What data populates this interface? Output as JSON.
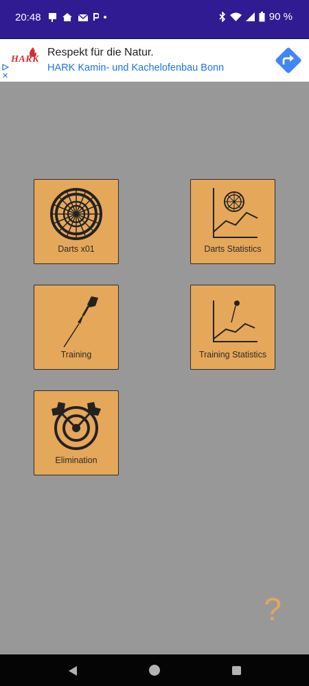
{
  "status_bar": {
    "time": "20:48",
    "battery": "90 %",
    "left_icons": [
      "parking-sign-icon",
      "home-icon",
      "mail-icon",
      "p-icon",
      "dot-icon"
    ],
    "right_icons": [
      "bluetooth-icon",
      "wifi-icon",
      "signal-icon",
      "battery-icon"
    ]
  },
  "ad": {
    "logo": "HARK",
    "title": "Respekt für die Natur.",
    "subtitle": "HARK Kamin- und Kachelofenbau Bonn",
    "close": "✕",
    "accent": "#1a73e8"
  },
  "tiles": {
    "darts_x01": {
      "label": "Darts x01",
      "icon": "dartboard-icon"
    },
    "darts_statistics": {
      "label": "Darts Statistics",
      "icon": "dartboard-chart-icon"
    },
    "training": {
      "label": "Training",
      "icon": "dart-icon"
    },
    "training_statistics": {
      "label": "Training Statistics",
      "icon": "dart-chart-icon"
    },
    "elimination": {
      "label": "Elimination",
      "icon": "target-arrows-icon"
    }
  },
  "help": {
    "label": "?"
  },
  "colors": {
    "background": "#999899",
    "status_bar": "#311b92",
    "tile": "#e5a75a",
    "help": "#e5a75a"
  },
  "nav": {
    "back_icon": "back-triangle-icon",
    "home_icon": "home-circle-icon",
    "recents_icon": "recents-square-icon"
  }
}
